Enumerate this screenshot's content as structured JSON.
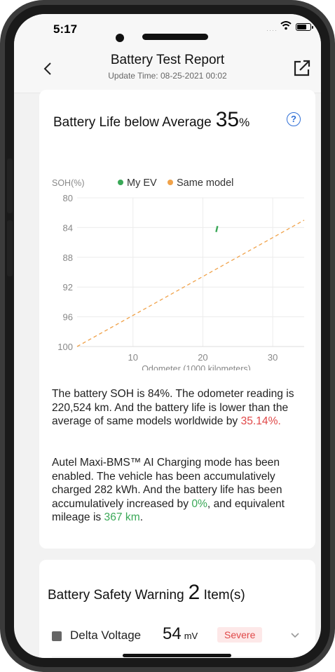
{
  "status_bar": {
    "time": "5:17"
  },
  "header": {
    "title": "Battery Test Report",
    "subtitle": "Update Time: 08-25-2021 00:02"
  },
  "battery_life": {
    "label": "Battery Life below Average",
    "value": "35",
    "unit": "%"
  },
  "chart_data": {
    "type": "line",
    "y_axis_label": "SOH(%)",
    "xlabel": "Odometer (1000 kilometers)",
    "ylim": [
      100,
      80
    ],
    "y_ticks": [
      "80",
      "84",
      "88",
      "92",
      "96",
      "100"
    ],
    "x_ticks": [
      "10",
      "20",
      "30"
    ],
    "xlim": [
      2,
      34.5
    ],
    "grid": true,
    "legend_position": "top",
    "series": [
      {
        "name": "My EV",
        "color": "#3aa857",
        "style": "solid",
        "points": [
          [
            21.9,
            84.6
          ],
          [
            22.1,
            83.8
          ]
        ]
      },
      {
        "name": "Same model",
        "color": "#f0a24a",
        "style": "dashed",
        "points": [
          [
            2,
            100
          ],
          [
            34.5,
            83
          ]
        ]
      }
    ]
  },
  "description": {
    "p1_text": "The battery SOH is 84%. The odometer reading is 220,524 km. And the battery life is lower than the average of same models worldwide by ",
    "p1_highlight": "35.14%.",
    "p2_text_a": "Autel Maxi-BMS™ AI Charging mode has been enabled. The vehicle has been accumulatively charged 282 kWh. And the battery life has been accumulatively increased by ",
    "p2_highlight_a": "0%",
    "p2_text_b": ", and equivalent mileage is ",
    "p2_highlight_b": "367 km",
    "p2_text_c": "."
  },
  "safety": {
    "label": "Battery Safety Warning",
    "count": "2",
    "suffix": "Item(s)",
    "items": [
      {
        "label": "Delta Voltage",
        "value": "54",
        "unit": "mV",
        "badge": "Severe"
      }
    ]
  },
  "colors": {
    "accent_blue": "#2f6fd6",
    "severe_red": "#e04848",
    "positive_green": "#3aa857",
    "same_model_orange": "#f0a24a"
  }
}
